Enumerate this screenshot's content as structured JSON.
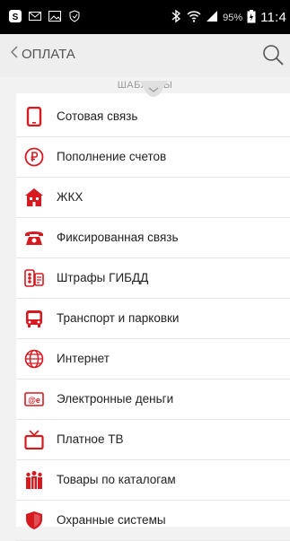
{
  "status_bar": {
    "battery": "95%",
    "time": "11:4",
    "icons": [
      "skype-icon",
      "mail-icon",
      "image-icon",
      "shield-icon",
      "bluetooth-icon",
      "wifi-icon",
      "signal-icon",
      "battery-icon"
    ]
  },
  "header": {
    "back_label": "ОПЛАТА"
  },
  "templates": {
    "label": "ШАБЛОНЫ"
  },
  "colors": {
    "accent": "#d71920",
    "statusbar": "#000000",
    "appbar": "#eeeeee"
  },
  "list": {
    "items": [
      {
        "label": "Сотовая связь",
        "icon": "mobile-phone-icon"
      },
      {
        "label": "Пополнение счетов",
        "icon": "ruble-icon"
      },
      {
        "label": "ЖКХ",
        "icon": "house-icon"
      },
      {
        "label": "Фиксированная связь",
        "icon": "landline-phone-icon"
      },
      {
        "label": "Штрафы ГИБДД",
        "icon": "traffic-fine-icon"
      },
      {
        "label": "Транспорт и парковки",
        "icon": "bus-icon"
      },
      {
        "label": "Интернет",
        "icon": "globe-icon"
      },
      {
        "label": "Электронные деньги",
        "icon": "emoney-icon"
      },
      {
        "label": "Платное ТВ",
        "icon": "tv-icon"
      },
      {
        "label": "Товары по каталогам",
        "icon": "people-icon"
      },
      {
        "label": "Охранные системы",
        "icon": "shield-icon"
      }
    ]
  }
}
